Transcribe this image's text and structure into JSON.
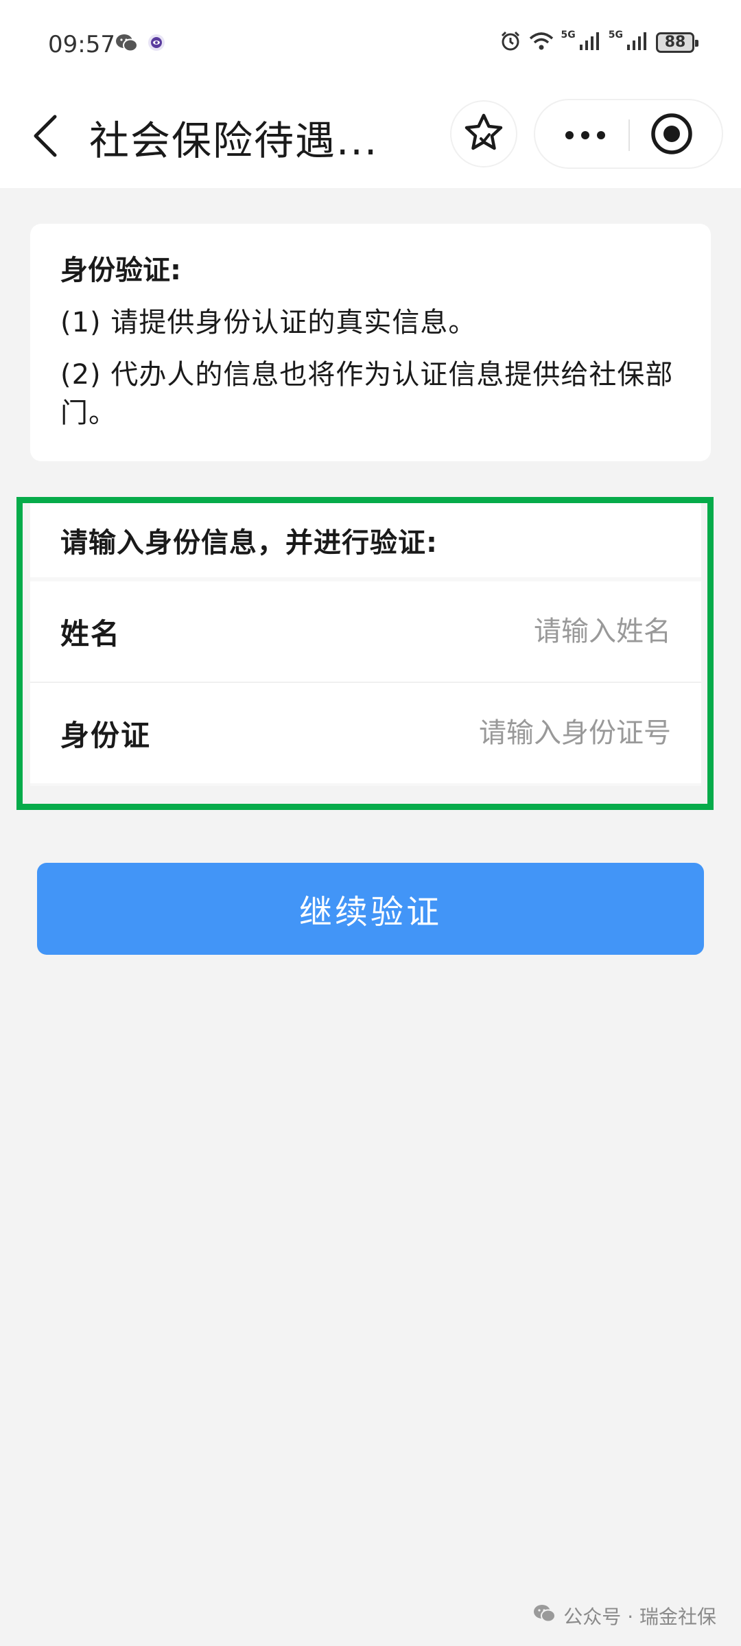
{
  "status_bar": {
    "time": "09:57",
    "signal1_label": "5G",
    "signal2_label": "5G",
    "battery": "88",
    "left_icons": [
      "wechat-icon",
      "app-notification-icon"
    ],
    "right_icons": [
      "alarm-icon",
      "wifi-icon",
      "signal-icon",
      "signal-icon",
      "battery-icon"
    ]
  },
  "nav": {
    "title": "社会保险待遇...",
    "back_icon": "chevron-left-icon",
    "favorite_icon": "star-icon",
    "more_icon": "more-dots-icon",
    "close_icon": "target-close-icon"
  },
  "notice": {
    "title": "身份验证:",
    "line1": "(1) 请提供身份认证的真实信息。",
    "line2": "(2) 代办人的信息也将作为认证信息提供给社保部门。"
  },
  "form": {
    "header": "请输入身份信息，并进行验证:",
    "name_label": "姓名",
    "name_placeholder": "请输入姓名",
    "name_value": "",
    "id_label": "身份证",
    "id_placeholder": "请输入身份证号",
    "id_value": ""
  },
  "button": {
    "continue_label": "继续验证"
  },
  "watermark": {
    "text": "公众号 · 瑞金社保"
  },
  "colors": {
    "highlight_border": "#06ab4a",
    "button_bg": "#4295f7",
    "page_bg": "#f3f3f3"
  }
}
